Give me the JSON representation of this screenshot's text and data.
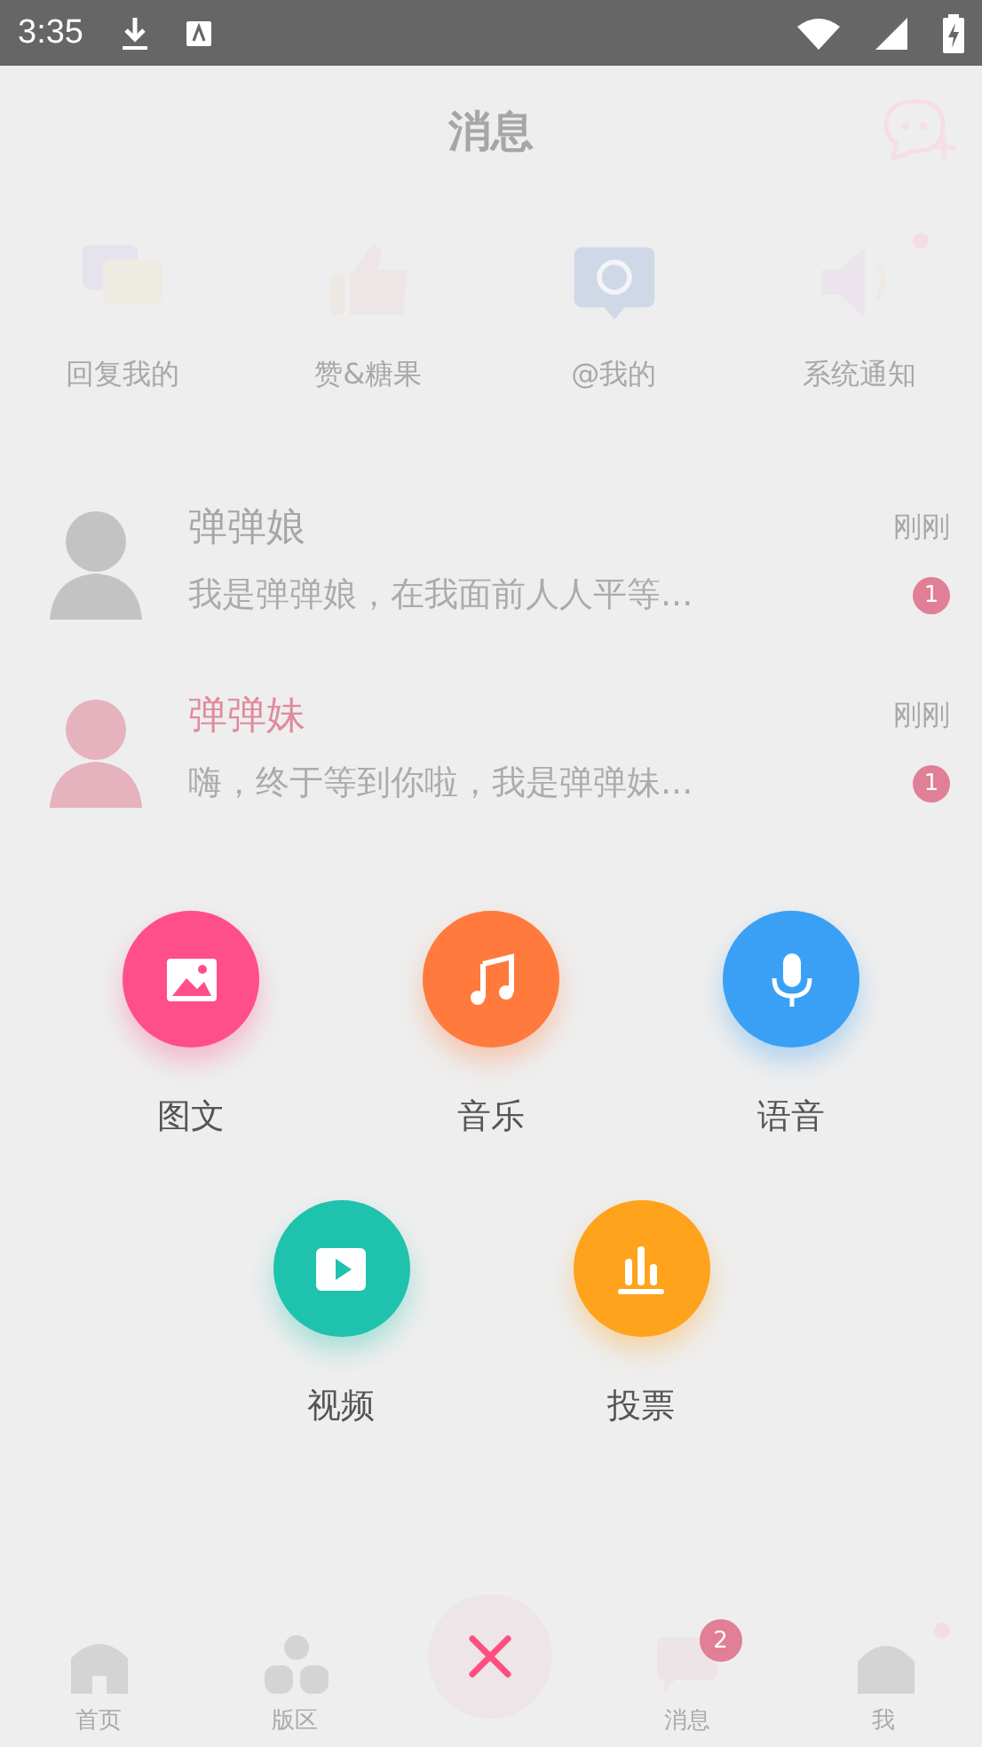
{
  "status_bar": {
    "time": "3:35"
  },
  "header": {
    "title": "消息"
  },
  "categories": [
    {
      "label": "回复我的",
      "kind": "reply",
      "unread": false
    },
    {
      "label": "赞&糖果",
      "kind": "like",
      "unread": false
    },
    {
      "label": "@我的",
      "kind": "at",
      "unread": false
    },
    {
      "label": "系统通知",
      "kind": "notice",
      "unread": true
    }
  ],
  "conversations": [
    {
      "name": "弹弹娘",
      "preview": "我是弹弹娘，在我面前人人平等...",
      "time": "刚刚",
      "badge": "1",
      "color": "#a6a6a6"
    },
    {
      "name": "弹弹妹",
      "preview": "嗨，终于等到你啦，我是弹弹妹...",
      "time": "刚刚",
      "badge": "1",
      "color": "#e08a9e"
    }
  ],
  "publish_menu": [
    {
      "label": "图文",
      "kind": "image",
      "color": "#ff4f8a"
    },
    {
      "label": "音乐",
      "kind": "music",
      "color": "#ff7a3c"
    },
    {
      "label": "语音",
      "kind": "voice",
      "color": "#3aa0f5"
    },
    {
      "label": "视频",
      "kind": "video",
      "color": "#1fc2ad"
    },
    {
      "label": "投票",
      "kind": "poll",
      "color": "#ffa21c"
    }
  ],
  "bottom_nav": [
    {
      "label": "首页",
      "kind": "home"
    },
    {
      "label": "版区",
      "kind": "board"
    },
    {
      "kind": "close"
    },
    {
      "label": "消息",
      "kind": "message",
      "badge": "2"
    },
    {
      "label": "我",
      "kind": "me",
      "dot": true
    }
  ]
}
